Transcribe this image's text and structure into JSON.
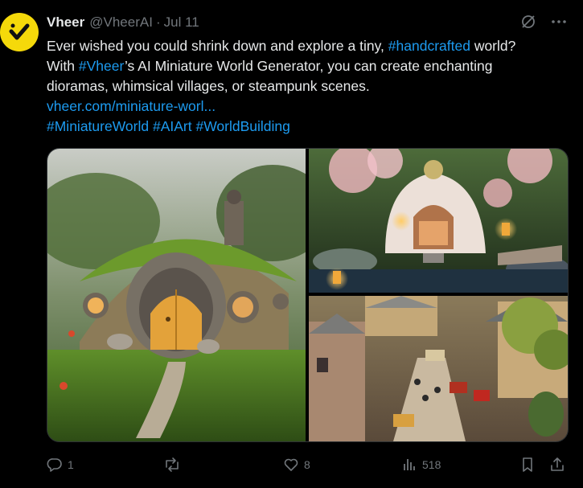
{
  "author": {
    "display_name": "Vheer",
    "handle": "@VheerAI",
    "separator": "·",
    "date": "Jul 11",
    "avatar_icon": "vheer-logo-icon",
    "avatar_color": "#f5d90a"
  },
  "tweet": {
    "line1_pre": "Ever wished you could shrink down and explore a tiny, ",
    "line1_hashtag": "#handcrafted",
    "line1_post": " world?",
    "line2_pre": "With ",
    "line2_hashtag": "#Vheer",
    "line2_post": "’s AI Miniature World Generator, you can create enchanting",
    "line3": "dioramas, whimsical villages, or steampunk scenes.",
    "link": "vheer.com/miniature-worl...",
    "hashtag1": "#MiniatureWorld",
    "hashtag2": "#AIArt",
    "hashtag3": "#WorldBuilding"
  },
  "media": {
    "images": [
      {
        "icon": "hobbit-house-image"
      },
      {
        "icon": "egg-house-garden-image"
      },
      {
        "icon": "miniature-village-street-image"
      }
    ]
  },
  "actions": {
    "reply_count": "1",
    "repost_count": "",
    "like_count": "8",
    "view_count": "518"
  },
  "colors": {
    "background": "#000000",
    "text": "#e7e9ea",
    "muted": "#71767b",
    "link": "#1d9bf0"
  }
}
